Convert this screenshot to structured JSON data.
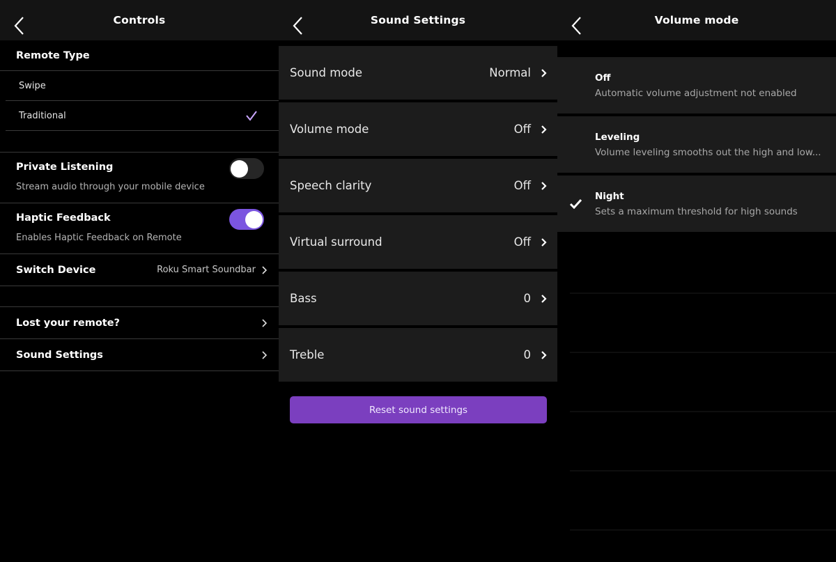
{
  "colors": {
    "accent_purple": "#7b3fbf",
    "toggle_on": "#7b55e0",
    "check_purple": "#c9a6ff",
    "row_bg": "#1c1c1c",
    "header_bg": "#141414"
  },
  "controls": {
    "header": {
      "title": "Controls",
      "back_icon": "chevron-left-icon"
    },
    "remote_type": {
      "heading": "Remote Type",
      "options": [
        {
          "label": "Swipe",
          "selected": false
        },
        {
          "label": "Traditional",
          "selected": true
        }
      ]
    },
    "private_listening": {
      "title": "Private Listening",
      "subtitle": "Stream audio through your mobile device",
      "enabled": false
    },
    "haptic_feedback": {
      "title": "Haptic Feedback",
      "subtitle": "Enables Haptic Feedback on Remote",
      "enabled": true
    },
    "switch_device": {
      "label": "Switch Device",
      "value": "Roku Smart Soundbar"
    },
    "lost_remote": {
      "label": "Lost your remote?"
    },
    "sound_settings": {
      "label": "Sound Settings"
    }
  },
  "sound_settings": {
    "header": {
      "title": "Sound Settings",
      "back_icon": "chevron-left-icon"
    },
    "rows": [
      {
        "label": "Sound mode",
        "value": "Normal"
      },
      {
        "label": "Volume mode",
        "value": "Off"
      },
      {
        "label": "Speech clarity",
        "value": "Off"
      },
      {
        "label": "Virtual surround",
        "value": "Off"
      },
      {
        "label": "Bass",
        "value": "0"
      },
      {
        "label": "Treble",
        "value": "0"
      }
    ],
    "reset_label": "Reset sound settings"
  },
  "volume_mode": {
    "header": {
      "title": "Volume mode",
      "back_icon": "chevron-left-icon"
    },
    "options": [
      {
        "title": "Off",
        "subtitle": "Automatic volume adjustment not enabled",
        "selected": false
      },
      {
        "title": "Leveling",
        "subtitle": "Volume leveling smooths out the high and low...",
        "selected": false
      },
      {
        "title": "Night",
        "subtitle": "Sets a maximum threshold for high sounds",
        "selected": true
      }
    ]
  }
}
